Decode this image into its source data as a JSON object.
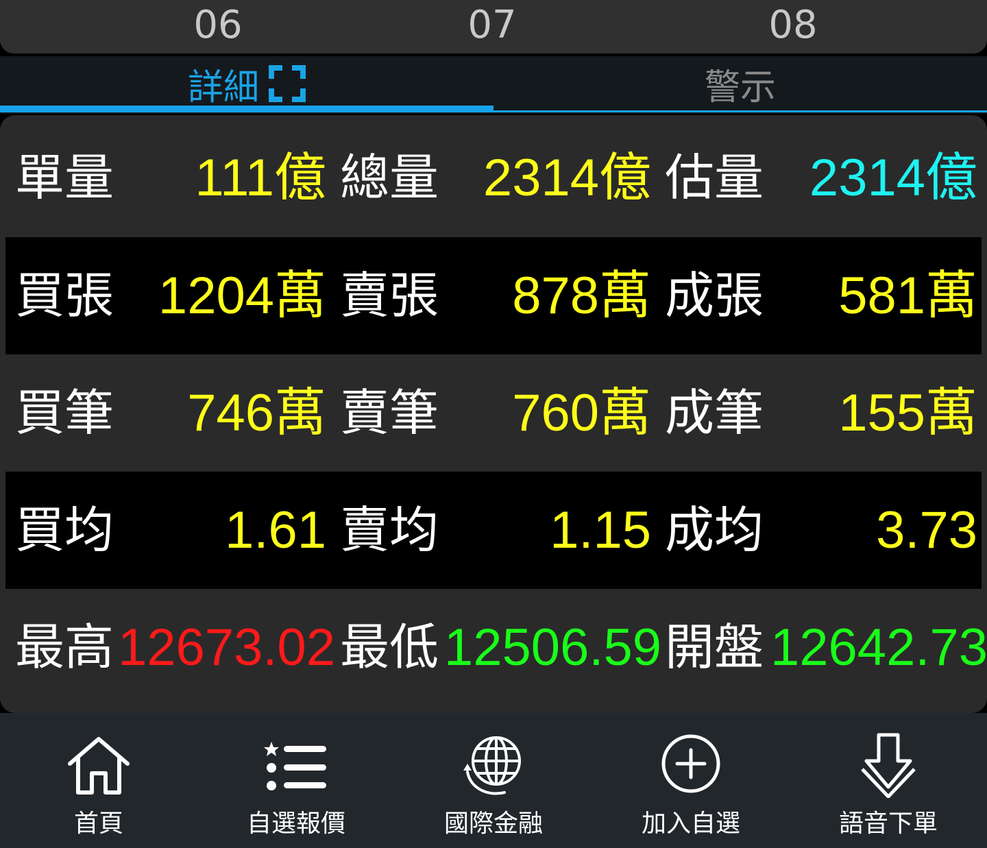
{
  "months": [
    "06",
    "07",
    "08"
  ],
  "tabs": {
    "detail": "詳細",
    "alert": "警示"
  },
  "stats": [
    {
      "label1": "單量",
      "value1": "111億",
      "label2": "總量",
      "value2": "2314億",
      "label3": "估量",
      "value3": "2314億"
    },
    {
      "label1": "買張",
      "value1": "1204萬",
      "label2": "賣張",
      "value2": "878萬",
      "label3": "成張",
      "value3": "581萬"
    },
    {
      "label1": "買筆",
      "value1": "746萬",
      "label2": "賣筆",
      "value2": "760萬",
      "label3": "成筆",
      "value3": "155萬"
    },
    {
      "label1": "買均",
      "value1": "1.61",
      "label2": "賣均",
      "value2": "1.15",
      "label3": "成均",
      "value3": "3.73"
    },
    {
      "label1": "最高",
      "value1": "12673.02",
      "label2": "最低",
      "value2": "12506.59",
      "label3": "開盤",
      "value3": "12642.73"
    }
  ],
  "colors": {
    "accent": "#16a2e8",
    "value_default": "#ffff1a",
    "value_estimate": "#1ff2f2",
    "value_high": "#ff1a1a",
    "value_low_open": "#1aff1a"
  },
  "nav": [
    {
      "label": "首頁",
      "icon": "home-icon"
    },
    {
      "label": "自選報價",
      "icon": "favorites-list-icon"
    },
    {
      "label": "國際金融",
      "icon": "globe-icon"
    },
    {
      "label": "加入自選",
      "icon": "add-circle-icon"
    },
    {
      "label": "語音下單",
      "icon": "download-arrow-icon"
    }
  ]
}
